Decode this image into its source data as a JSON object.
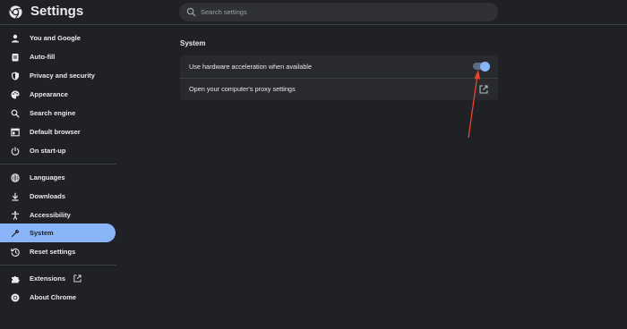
{
  "header": {
    "title": "Settings",
    "search": {
      "placeholder": "Search settings"
    }
  },
  "sidebar": {
    "items": [
      {
        "label": "You and Google",
        "icon": "person-icon"
      },
      {
        "label": "Auto-fill",
        "icon": "clipboard-icon"
      },
      {
        "label": "Privacy and security",
        "icon": "shield-icon"
      },
      {
        "label": "Appearance",
        "icon": "palette-icon"
      },
      {
        "label": "Search engine",
        "icon": "search-icon"
      },
      {
        "label": "Default browser",
        "icon": "browser-icon"
      },
      {
        "label": "On start-up",
        "icon": "power-icon"
      },
      {
        "label": "Languages",
        "icon": "globe-icon"
      },
      {
        "label": "Downloads",
        "icon": "download-icon"
      },
      {
        "label": "Accessibility",
        "icon": "accessibility-icon"
      },
      {
        "label": "System",
        "icon": "wrench-icon",
        "active": true
      },
      {
        "label": "Reset settings",
        "icon": "history-icon"
      },
      {
        "label": "Extensions",
        "icon": "puzzle-icon"
      },
      {
        "label": "About Chrome",
        "icon": "chrome-icon"
      }
    ]
  },
  "main": {
    "section_title": "System",
    "rows": [
      {
        "label": "Use hardware acceleration when available",
        "control": "toggle",
        "checked": true
      },
      {
        "label": "Open your computer's proxy settings",
        "control": "open-in-new-icon"
      }
    ]
  },
  "colors": {
    "background": "#202124",
    "card": "#292a2d",
    "accent": "#8ab4f8",
    "text": "#e8eaed",
    "annotation_arrow": "#e8442f"
  }
}
